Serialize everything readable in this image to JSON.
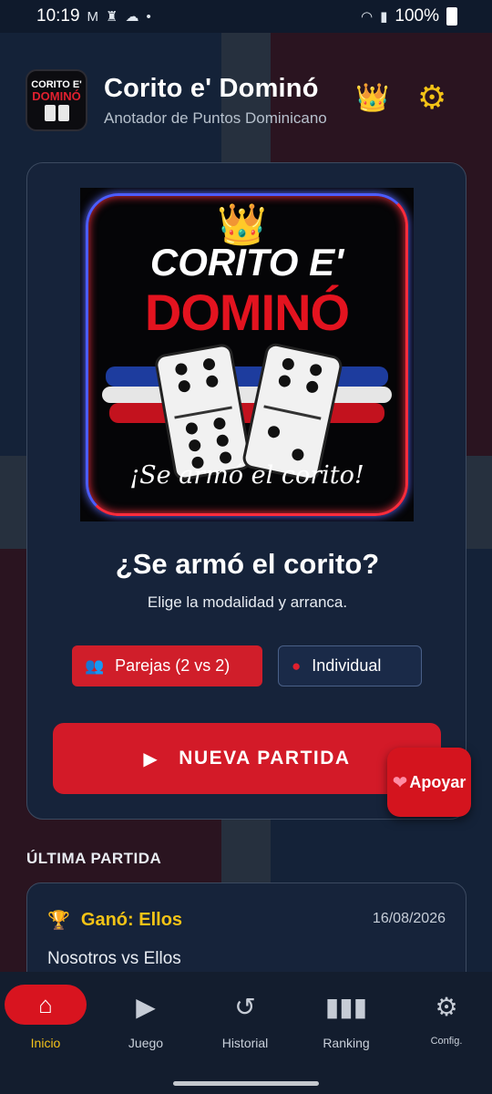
{
  "status_bar": {
    "time": "10:19",
    "battery": "100%",
    "icons": [
      "gmail-icon",
      "chess-icon",
      "cloud-icon",
      "dot-icon",
      "wifi-icon",
      "signal-icon",
      "battery-icon"
    ]
  },
  "header": {
    "title": "Corito e' Dominó",
    "subtitle": "Anotador de Puntos Dominicano",
    "logo_line1": "CORITO E'",
    "logo_line2": "DOMINÓ",
    "crown_icon": "👑",
    "settings_icon": "⚙"
  },
  "hero": {
    "title_top": "CORITO E'",
    "title_main": "DOMINÓ",
    "tagline": "¡Se armó el corito!",
    "crown_icon": "👑"
  },
  "main": {
    "headline": "¿Se armó el corito?",
    "subheadline": "Elige la modalidad y arranca.",
    "mode_pairs_label": "Parejas (2 vs 2)",
    "mode_individual_label": "Individual",
    "selected_mode": "Parejas (2 vs 2)",
    "new_game_label": "NUEVA PARTIDA"
  },
  "support_button": {
    "label": "Apoyar",
    "icon": "❤"
  },
  "last_game": {
    "section_title": "ÚLTIMA PARTIDA",
    "winner_text": "Ganó: Ellos",
    "date": "16/08/2026",
    "teams": "Nosotros vs Ellos"
  },
  "bottom_nav": {
    "items": [
      {
        "label": "Inicio",
        "icon": "home-icon",
        "active": true
      },
      {
        "label": "Juego",
        "icon": "play-circle-icon",
        "active": false
      },
      {
        "label": "Historial",
        "icon": "history-icon",
        "active": false
      },
      {
        "label": "Ranking",
        "icon": "bar-chart-icon",
        "active": false
      },
      {
        "label": "Config.",
        "icon": "gear-icon",
        "active": false
      }
    ]
  },
  "colors": {
    "accent_red": "#d31a28",
    "accent_gold": "#f3c316",
    "background": "#0f1a2c",
    "card": "#16233a"
  }
}
